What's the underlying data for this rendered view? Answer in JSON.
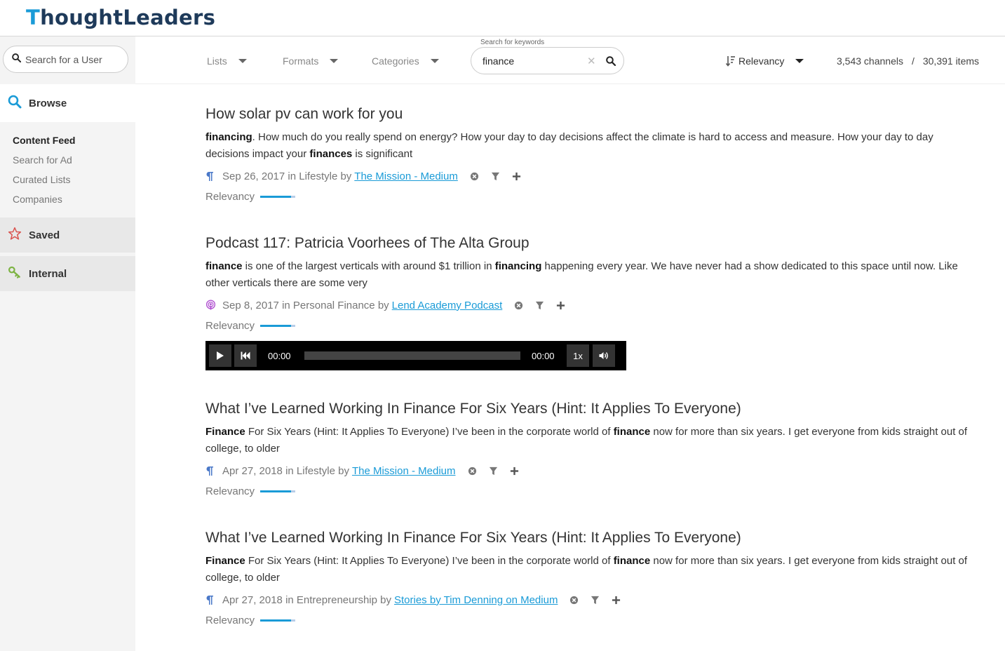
{
  "header": {
    "logo_first": "T",
    "logo_rest": "houghtLeaders"
  },
  "sidebar": {
    "user_search_placeholder": "Search for a User",
    "browse_label": "Browse",
    "sub_items": [
      "Content Feed",
      "Search for Ad",
      "Curated Lists",
      "Companies"
    ],
    "saved_label": "Saved",
    "internal_label": "Internal"
  },
  "filters": {
    "lists": "Lists",
    "formats": "Formats",
    "categories": "Categories",
    "keyword_label": "Search for keywords",
    "keyword_value": "finance",
    "sort_label": "Relevancy",
    "channels": "3,543 channels",
    "separator": "/",
    "items": "30,391 items"
  },
  "items": [
    {
      "title": "How solar pv can work for you",
      "type": "article",
      "snippet": [
        {
          "b": "financing"
        },
        {
          "t": ". How much do you really spend on energy? How your day to day decisions affect the climate is hard to access and measure. How your day to day decisions impact your "
        },
        {
          "b": "finances"
        },
        {
          "t": " is significant"
        }
      ],
      "date_category": "Sep 26, 2017 in Lifestyle by",
      "channel": "The Mission - Medium",
      "relevancy_label": "Relevancy",
      "relevancy": 0.88
    },
    {
      "title": "Podcast 117: Patricia Voorhees of The Alta Group",
      "type": "podcast",
      "snippet": [
        {
          "b": "finance"
        },
        {
          "t": " is one of the largest verticals with around $1 trillion in "
        },
        {
          "b": "financing"
        },
        {
          "t": " happening every year. We have never had a show dedicated to this space until now. Like other verticals there are some very"
        }
      ],
      "date_category": "Sep 8, 2017 in Personal Finance by",
      "channel": "Lend Academy Podcast",
      "relevancy_label": "Relevancy",
      "relevancy": 0.88
    },
    {
      "title": "What I’ve Learned Working In Finance For Six Years (Hint: It Applies To Everyone)",
      "type": "article",
      "snippet": [
        {
          "b": "Finance"
        },
        {
          "t": " For Six Years (Hint: It Applies To Everyone) I’ve been in the corporate world of "
        },
        {
          "b": "finance"
        },
        {
          "t": " now for more than six years. I get everyone from kids straight out of college, to older"
        }
      ],
      "date_category": "Apr 27, 2018 in Lifestyle by",
      "channel": "The Mission - Medium",
      "relevancy_label": "Relevancy",
      "relevancy": 0.88
    },
    {
      "title": "What I’ve Learned Working In Finance For Six Years (Hint: It Applies To Everyone)",
      "type": "article",
      "snippet": [
        {
          "b": "Finance"
        },
        {
          "t": " For Six Years (Hint: It Applies To Everyone) I’ve been in the corporate world of "
        },
        {
          "b": "finance"
        },
        {
          "t": " now for more than six years. I get everyone from kids straight out of college, to older"
        }
      ],
      "date_category": "Apr 27, 2018 in Entrepreneurship by",
      "channel": "Stories by Tim Denning on Medium",
      "relevancy_label": "Relevancy",
      "relevancy": 0.88
    }
  ],
  "player": {
    "current": "00:00",
    "duration": "00:00",
    "rate": "1x"
  },
  "colors": {
    "accent": "#1a9bd7",
    "logo": "#1e3a5a",
    "saved_star": "#d9534f",
    "internal_key": "#7cb342",
    "podcast": "#b050d0"
  }
}
